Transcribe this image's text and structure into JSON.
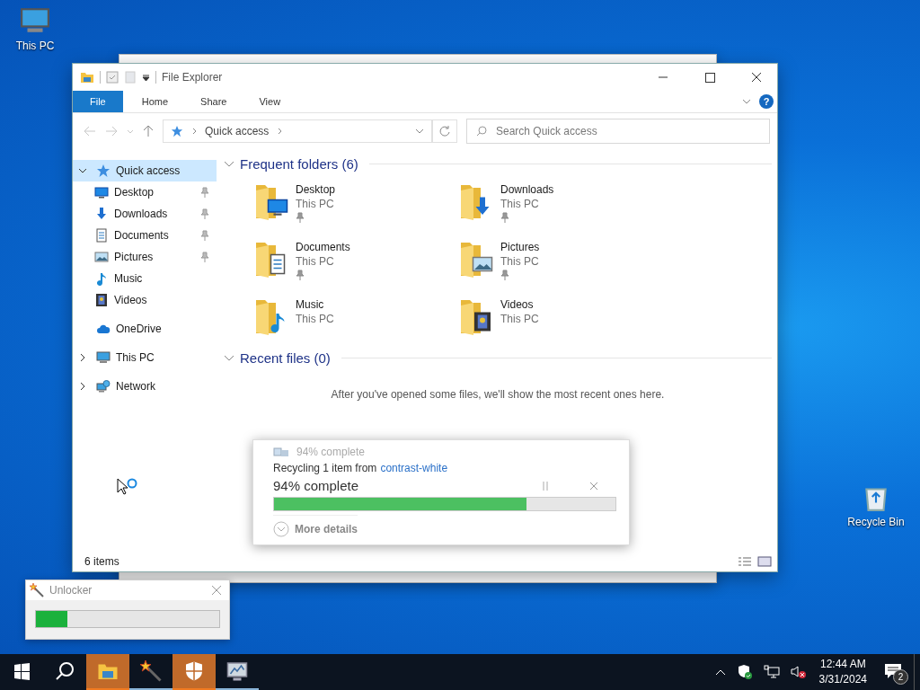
{
  "desktop_icons": [
    {
      "label": "This PC",
      "kind": "pc"
    },
    {
      "label": "Recycle Bin",
      "kind": "bin"
    }
  ],
  "explorer": {
    "title": "File Explorer",
    "help": "?",
    "ribbon_tabs": [
      {
        "label": "File",
        "selected": true
      },
      {
        "label": "Home",
        "selected": false
      },
      {
        "label": "Share",
        "selected": false
      },
      {
        "label": "View",
        "selected": false
      }
    ],
    "address": "Quick access",
    "search": {
      "placeholder": "Search Quick access"
    },
    "nav": [
      {
        "label": "Quick access",
        "kind": "star",
        "selected": true,
        "expanded": true,
        "children": [
          {
            "label": "Desktop",
            "kind": "desktop",
            "selected": false,
            "pinned": true
          },
          {
            "label": "Downloads",
            "kind": "downloads",
            "selected": false,
            "pinned": true
          },
          {
            "label": "Documents",
            "kind": "documents",
            "selected": false,
            "pinned": true
          },
          {
            "label": "Pictures",
            "kind": "pictures",
            "selected": false,
            "pinned": true
          },
          {
            "label": "Music",
            "kind": "music",
            "selected": false,
            "pinned": false
          },
          {
            "label": "Videos",
            "kind": "videos",
            "selected": false,
            "pinned": false
          }
        ]
      },
      {
        "label": "OneDrive",
        "kind": "cloud",
        "selected": false
      },
      {
        "label": "This PC",
        "kind": "pc",
        "selected": false,
        "expanded": false
      },
      {
        "label": "Network",
        "kind": "network",
        "selected": false,
        "expanded": false
      }
    ],
    "frequent": {
      "title": "Frequent folders (6)",
      "expanded": true,
      "items": [
        {
          "name": "Desktop",
          "location": "This PC",
          "kind": "desktop",
          "pinned": true
        },
        {
          "name": "Downloads",
          "location": "This PC",
          "kind": "downloads",
          "pinned": true
        },
        {
          "name": "Documents",
          "location": "This PC",
          "kind": "documents",
          "pinned": true
        },
        {
          "name": "Pictures",
          "location": "This PC",
          "kind": "pictures",
          "pinned": true
        },
        {
          "name": "Music",
          "location": "This PC",
          "kind": "music",
          "pinned": false
        },
        {
          "name": "Videos",
          "location": "This PC",
          "kind": "videos",
          "pinned": false
        }
      ]
    },
    "recent": {
      "title": "Recent files (0)",
      "expanded": true,
      "empty_text": "After you've opened some files, we'll show the most recent ones here."
    },
    "status": "6 items"
  },
  "progress_dialog": {
    "title": "94% complete",
    "message": "Recycling 1 item from",
    "source": "contrast-white",
    "headline": "94% complete",
    "level": 0.74,
    "details_label": "More details"
  },
  "unlocker": {
    "title": "Unlocker",
    "level": 0.17
  },
  "taskbar": {
    "apps": [
      {
        "kind": "explorer",
        "flashing": true
      },
      {
        "kind": "wand",
        "flashing": false
      },
      {
        "kind": "shield",
        "flashing": true
      },
      {
        "kind": "monitor",
        "flashing": false
      }
    ],
    "time": "12:44 AM",
    "date": "3/31/2024",
    "notifications": "2"
  }
}
